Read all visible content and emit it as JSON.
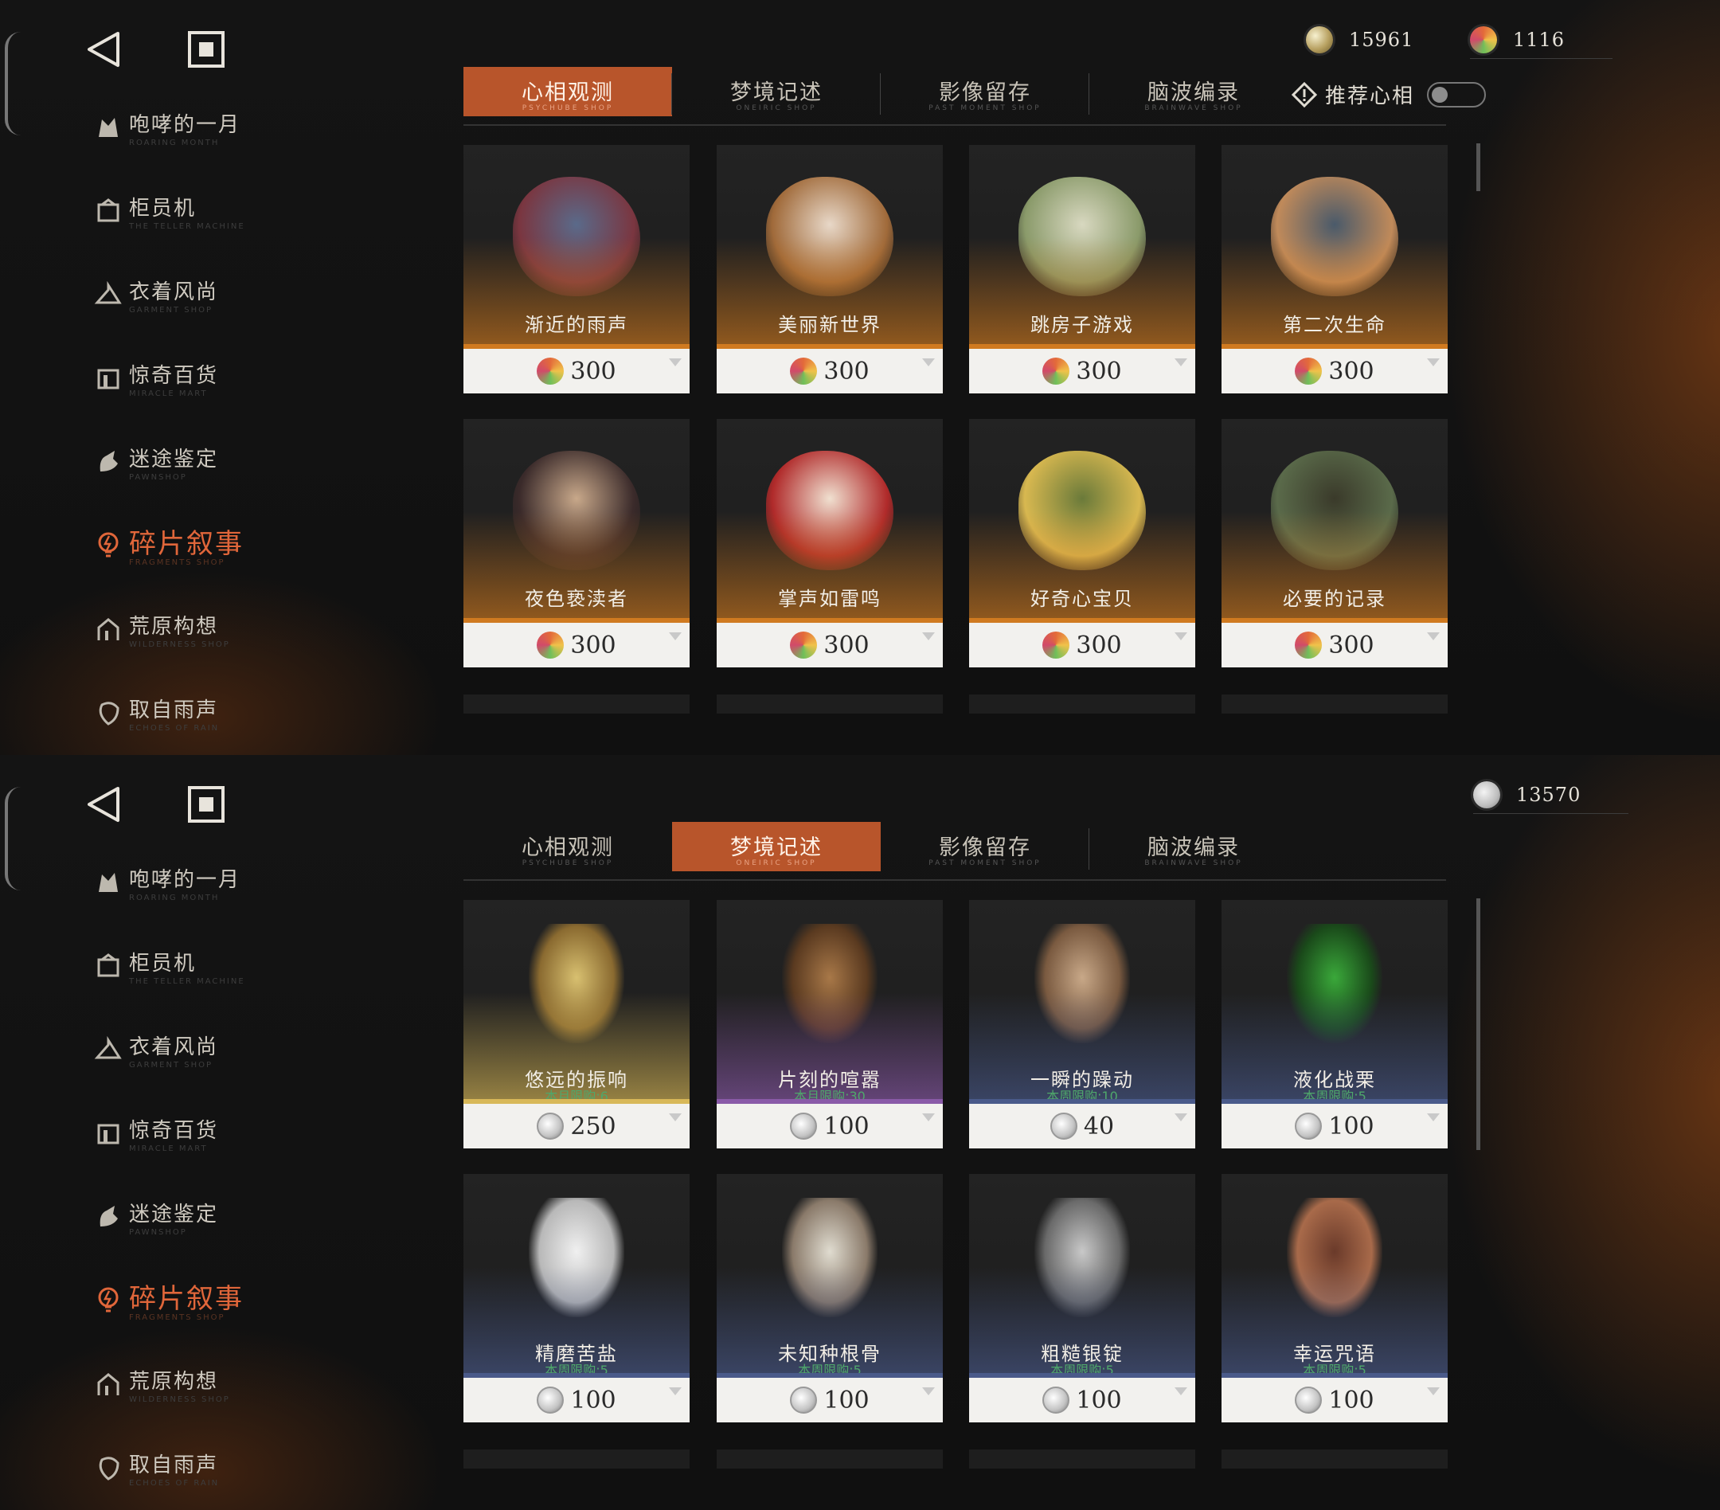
{
  "sidebar": {
    "items": [
      {
        "label": "咆哮的一月",
        "sub": "ROARING MONTH",
        "icon": "wolf-icon"
      },
      {
        "label": "柜员机",
        "sub": "THE TELLER MACHINE",
        "icon": "teller-icon"
      },
      {
        "label": "衣着风尚",
        "sub": "GARMENT SHOP",
        "icon": "hanger-icon"
      },
      {
        "label": "惊奇百货",
        "sub": "MIRACLE MART",
        "icon": "shop-icon"
      },
      {
        "label": "迷途鉴定",
        "sub": "PAWNSHOP",
        "icon": "hand-icon"
      },
      {
        "label": "碎片叙事",
        "sub": "FRAGMENTS SHOP",
        "icon": "bulb-icon",
        "active": true
      },
      {
        "label": "荒原构想",
        "sub": "WILDERNESS SHOP",
        "icon": "house-icon"
      },
      {
        "label": "取自雨声",
        "sub": "ECHOES OF RAIN",
        "icon": "leaf-icon"
      }
    ]
  },
  "tabs": [
    {
      "label": "心相观测",
      "sub": "PSYCHUBE SHOP"
    },
    {
      "label": "梦境记述",
      "sub": "ONEIRIC SHOP"
    },
    {
      "label": "影像留存",
      "sub": "PAST MOMENT SHOP"
    },
    {
      "label": "脑波编录",
      "sub": "BRAINWAVE SHOP"
    }
  ],
  "panel1": {
    "currencies": [
      {
        "value": "15961",
        "icon": "gem-icon"
      },
      {
        "value": "1116",
        "icon": "swirl-icon"
      }
    ],
    "active_tab": 0,
    "recommend_label": "推荐心相",
    "cards": [
      {
        "name": "渐近的雨声",
        "price": "300",
        "colors": [
          "#7a3640",
          "#5a6a8a"
        ]
      },
      {
        "name": "美丽新世界",
        "price": "300",
        "colors": [
          "#a06a3a",
          "#e8d8c8"
        ]
      },
      {
        "name": "跳房子游戏",
        "price": "300",
        "colors": [
          "#8a9a6a",
          "#d8d8c0"
        ]
      },
      {
        "name": "第二次生命",
        "price": "300",
        "colors": [
          "#c08a5a",
          "#4a5a6a"
        ]
      },
      {
        "name": "夜色亵渎者",
        "price": "300",
        "colors": [
          "#3a2a2a",
          "#c8a88a"
        ]
      },
      {
        "name": "掌声如雷鸣",
        "price": "300",
        "colors": [
          "#b02a2a",
          "#f0e0d0"
        ]
      },
      {
        "name": "好奇心宝贝",
        "price": "300",
        "colors": [
          "#d8b850",
          "#6a7a3a"
        ]
      },
      {
        "name": "必要的记录",
        "price": "300",
        "colors": [
          "#5a6a4a",
          "#3a3a2a"
        ]
      }
    ]
  },
  "panel2": {
    "currencies": [
      {
        "value": "13570",
        "icon": "moon-coin-icon"
      }
    ],
    "active_tab": 1,
    "cards": [
      {
        "name": "悠远的振响",
        "limit": "本月限购:6",
        "price": "250",
        "bar": "#d8b858",
        "colors": [
          "#d8c070",
          "#8a6a30"
        ]
      },
      {
        "name": "片刻的喧嚣",
        "limit": "本月限购:30",
        "price": "100",
        "bar": "#8a5aa8",
        "colors": [
          "#a87848",
          "#5a3a20"
        ]
      },
      {
        "name": "一瞬的躁动",
        "limit": "本周限购:10",
        "price": "40",
        "bar": "#4a5a8a",
        "colors": [
          "#c8a888",
          "#7a5a40"
        ]
      },
      {
        "name": "液化战栗",
        "limit": "本周限购:5",
        "price": "100",
        "bar": "#4a5a8a",
        "colors": [
          "#3aa83a",
          "#1a4a1a"
        ]
      },
      {
        "name": "精磨苦盐",
        "limit": "本周限购:5",
        "price": "100",
        "bar": "#4a5a8a",
        "colors": [
          "#f0f0f0",
          "#b8b8b8"
        ]
      },
      {
        "name": "未知种根骨",
        "limit": "本周限购:5",
        "price": "100",
        "bar": "#4a5a8a",
        "colors": [
          "#e0dcd0",
          "#8a7a6a"
        ]
      },
      {
        "name": "粗糙银锭",
        "limit": "本周限购:5",
        "price": "100",
        "bar": "#4a5a8a",
        "colors": [
          "#c8c8c8",
          "#6a6a6a"
        ]
      },
      {
        "name": "幸运咒语",
        "limit": "本周限购:5",
        "price": "100",
        "bar": "#4a5a8a",
        "colors": [
          "#6a3a2a",
          "#a86a4a"
        ]
      }
    ]
  },
  "colors": {
    "accent": "#b8552b",
    "active_text": "#e0663a",
    "card_bg": "#1c1c1c",
    "price_bg": "#f2f1ee"
  }
}
